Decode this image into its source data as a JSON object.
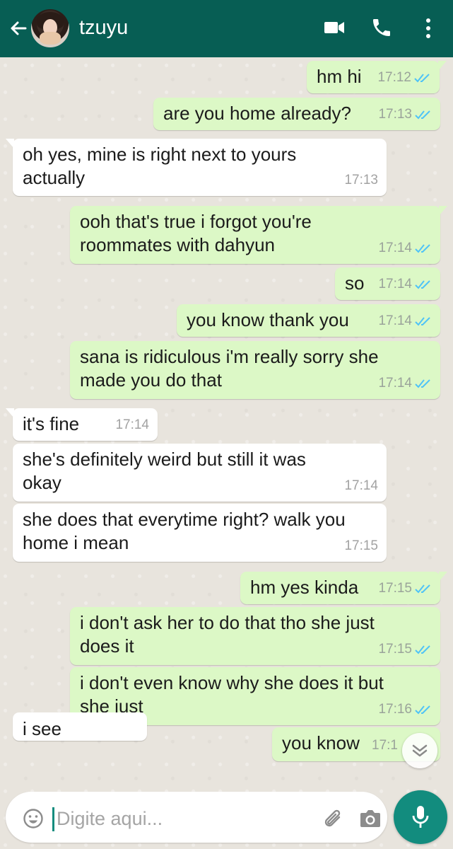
{
  "header": {
    "contact_name": "tzuyu",
    "back_icon": "arrow-left-icon",
    "video_icon": "video-call-icon",
    "call_icon": "phone-icon",
    "menu_icon": "more-vertical-icon",
    "background_color": "#075e54"
  },
  "messages": [
    {
      "direction": "out",
      "text": "hm hi",
      "time": "17:12",
      "status": "read"
    },
    {
      "direction": "out",
      "text": "are you home already?",
      "time": "17:13",
      "status": "read"
    },
    {
      "direction": "in",
      "text": "oh yes, mine is right next to yours\nactually",
      "time": "17:13"
    },
    {
      "direction": "out",
      "text": "ooh that's true i forgot you're\nroommates with dahyun",
      "time": "17:14",
      "status": "read"
    },
    {
      "direction": "out",
      "text": "so",
      "time": "17:14",
      "status": "read"
    },
    {
      "direction": "out",
      "text": "you know thank you",
      "time": "17:14",
      "status": "read"
    },
    {
      "direction": "out",
      "text": "sana is ridiculous i'm really sorry she\nmade you do that",
      "time": "17:14",
      "status": "read"
    },
    {
      "direction": "in",
      "text": "it's fine",
      "time": "17:14"
    },
    {
      "direction": "in",
      "text": "she's definitely weird but still it was\nokay",
      "time": "17:14"
    },
    {
      "direction": "in",
      "text": "she does that everytime right? walk you\nhome i mean",
      "time": "17:15"
    },
    {
      "direction": "out",
      "text": "hm yes kinda",
      "time": "17:15",
      "status": "read"
    },
    {
      "direction": "out",
      "text": "i don't ask her to do that tho she just\ndoes it",
      "time": "17:15",
      "status": "read"
    },
    {
      "direction": "out",
      "text": "i don't even know why she does it but\nshe just",
      "time": "17:16",
      "status": "read"
    },
    {
      "direction": "out",
      "text": "you know",
      "time": "17:1",
      "status": "read"
    },
    {
      "direction": "in",
      "text": "i see",
      "time": ""
    }
  ],
  "composer": {
    "placeholder": "Digite aqui...",
    "emoji_icon": "emoji-icon",
    "attach_icon": "paperclip-icon",
    "camera_icon": "camera-icon",
    "mic_icon": "microphone-icon"
  },
  "colors": {
    "outgoing_bubble": "#dcf8c6",
    "incoming_bubble": "#ffffff",
    "read_tick": "#4fc3f7",
    "accent": "#128c7e"
  }
}
